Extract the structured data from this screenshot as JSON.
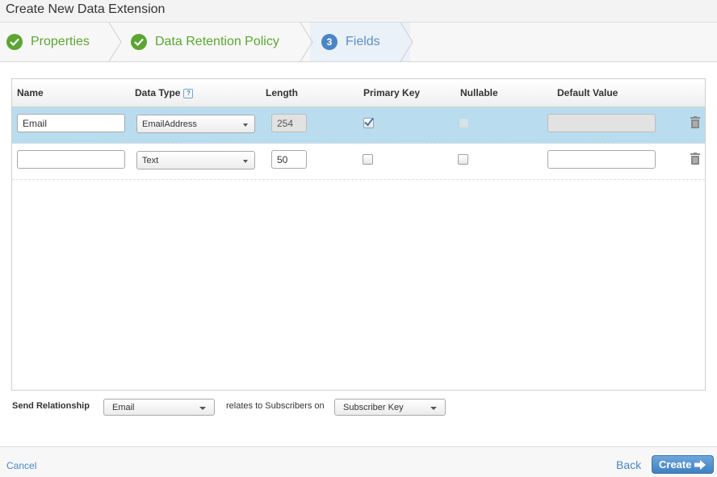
{
  "window": {
    "title": "Create New Data Extension"
  },
  "wizard": {
    "steps": [
      {
        "label": "Properties",
        "state": "done",
        "icon": "check-icon"
      },
      {
        "label": "Data Retention Policy",
        "state": "done",
        "icon": "check-icon"
      },
      {
        "label": "Fields",
        "state": "current",
        "number": "3"
      }
    ]
  },
  "table": {
    "columns": [
      "Name",
      "Data Type",
      "Length",
      "Primary Key",
      "Nullable",
      "Default Value"
    ],
    "help_icon": "?",
    "rows": [
      {
        "name": "Email",
        "data_type": "EmailAddress",
        "length": "254",
        "primary_key": true,
        "nullable": false,
        "default_value": "",
        "selected": true
      },
      {
        "name": "",
        "data_type": "Text",
        "length": "50",
        "primary_key": false,
        "nullable": false,
        "default_value": "",
        "selected": false
      }
    ]
  },
  "relationship": {
    "label": "Send Relationship",
    "field": "Email",
    "middle_text": "relates to Subscribers on",
    "subscriber_field": "Subscriber Key"
  },
  "footer": {
    "cancel": "Cancel",
    "back": "Back",
    "create": "Create"
  },
  "colors": {
    "done": "#5ba632",
    "current": "#4a86c5",
    "selected_row": "#b9dcef"
  }
}
